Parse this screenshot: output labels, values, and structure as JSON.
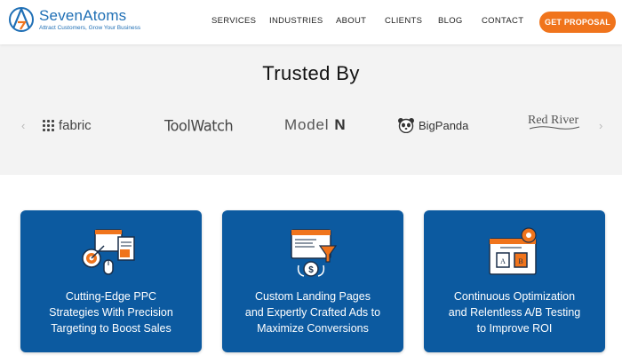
{
  "header": {
    "logo_name": "SevenAtoms",
    "logo_tagline": "Attract Customers, Grow Your Business",
    "nav": [
      "SERVICES",
      "INDUSTRIES",
      "ABOUT",
      "CLIENTS",
      "BLOG",
      "CONTACT"
    ],
    "cta_label": "GET PROPOSAL"
  },
  "colors": {
    "brand_blue": "#0c5aa0",
    "accent_orange": "#f0741c"
  },
  "trusted": {
    "title": "Trusted By",
    "logos": [
      "fabric",
      "ToolWatch",
      "Model",
      "N",
      "BigPanda",
      "Red River"
    ],
    "prev_icon": "chevron-left-icon",
    "next_icon": "chevron-right-icon"
  },
  "cards": [
    {
      "icon": "ppc-target-icon",
      "lines": [
        "Cutting-Edge PPC",
        "Strategies With Precision",
        "Targeting to Boost Sales"
      ]
    },
    {
      "icon": "landing-page-funnel-icon",
      "lines": [
        "Custom Landing Pages",
        "and Expertly Crafted Ads to",
        "Maximize Conversions"
      ]
    },
    {
      "icon": "ab-testing-gear-icon",
      "lines": [
        "Continuous Optimization",
        "and Relentless A/B Testing",
        "to Improve ROI"
      ]
    }
  ]
}
